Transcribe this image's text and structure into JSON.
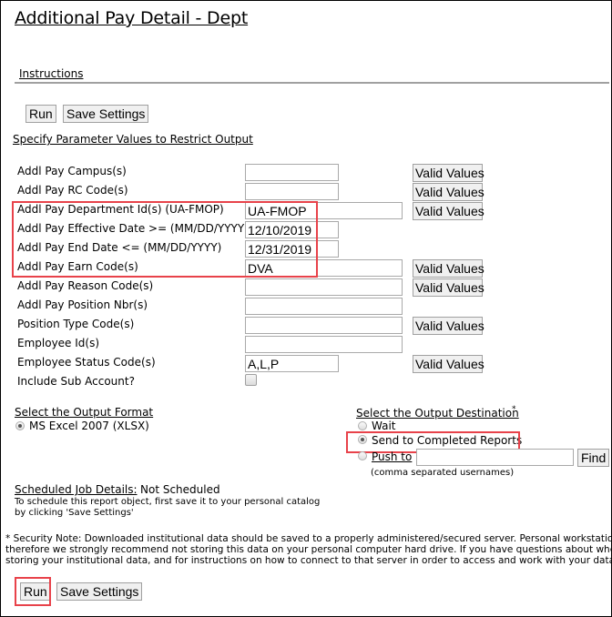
{
  "page": {
    "title": "Additional Pay Detail - Dept",
    "instructions_link": "Instructions"
  },
  "toolbar_top": {
    "run_label": "Run",
    "save_label": "Save Settings"
  },
  "parameters": {
    "heading": "Specify Parameter Values to Restrict Output",
    "valid_values_label": "Valid Values",
    "fields": [
      {
        "label": "Addl Pay Campus(s)",
        "value": "",
        "has_valid_values": true
      },
      {
        "label": "Addl Pay RC Code(s)",
        "value": "",
        "has_valid_values": true
      },
      {
        "label": "Addl Pay Department Id(s) (UA-FMOP)",
        "value": "UA-FMOP",
        "has_valid_values": true
      },
      {
        "label": "Addl Pay Effective Date >= (MM/DD/YYYY)",
        "value": "12/10/2019",
        "has_valid_values": false
      },
      {
        "label": "Addl Pay End Date <= (MM/DD/YYYY)",
        "value": "12/31/2019",
        "has_valid_values": false
      },
      {
        "label": "Addl Pay Earn Code(s)",
        "value": "DVA",
        "has_valid_values": true
      },
      {
        "label": "Addl Pay Reason Code(s)",
        "value": "",
        "has_valid_values": true
      },
      {
        "label": "Addl Pay Position Nbr(s)",
        "value": "",
        "has_valid_values": false
      },
      {
        "label": "Position Type Code(s)",
        "value": "",
        "has_valid_values": true
      },
      {
        "label": "Employee Id(s)",
        "value": "",
        "has_valid_values": false
      },
      {
        "label": "Employee Status Code(s)",
        "value": "A,L,P",
        "has_valid_values": true
      },
      {
        "label": "Include Sub Account?",
        "value": false,
        "type": "checkbox"
      }
    ]
  },
  "output_format": {
    "heading": "Select the Output Format",
    "options": [
      {
        "label": "MS Excel 2007 (XLSX)",
        "selected": true
      }
    ]
  },
  "output_destination": {
    "heading": "Select the Output Destination",
    "required_marker": "*",
    "options": [
      {
        "label": "Wait",
        "selected": false
      },
      {
        "label": "Send to Completed Reports",
        "selected": true
      },
      {
        "label": "Push to",
        "selected": false
      }
    ],
    "push_to_value": "",
    "find_label": "Find",
    "push_to_hint": "(comma separated usernames)"
  },
  "schedule": {
    "label": "Scheduled Job Details:",
    "status": "Not Scheduled",
    "help_line1": "To schedule this report object, first save it to your personal catalog",
    "help_line2": "by clicking 'Save Settings'"
  },
  "security_note": {
    "prefix": "* Security Note:",
    "line1": " Downloaded institutional data should be saved to a properly administered/secured server. Personal workstations may not",
    "line2": "therefore we strongly recommend not storing this data on your personal computer hard drive. If you have questions about whether or not",
    "line3": "storing your institutional data, and for instructions on how to connect to that server in order to access and work with your data, please co"
  },
  "toolbar_bottom": {
    "run_label": "Run",
    "save_label": "Save Settings"
  },
  "highlight_color": "#e8424a"
}
